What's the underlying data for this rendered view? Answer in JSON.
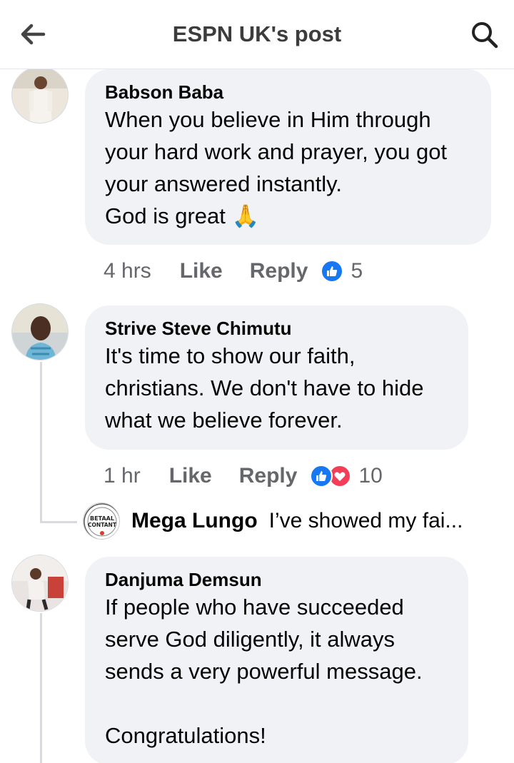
{
  "header": {
    "title": "ESPN UK's post",
    "back_icon": "back-arrow-icon",
    "search_icon": "search-icon"
  },
  "comments": [
    {
      "author": "Babson Baba",
      "text": "When you believe in Him through\nyour hard work and prayer, you got\nyour answered instantly.\nGod is great",
      "emoji": "🙏",
      "time": "4 hrs",
      "like_label": "Like",
      "reply_label": "Reply",
      "reactions": [
        "like"
      ],
      "reaction_count": "5"
    },
    {
      "author": "Strive Steve Chimutu",
      "text": "It's time to show our faith,\nchristians. We don't have to hide\nwhat we believe forever.",
      "time": "1 hr",
      "like_label": "Like",
      "reply_label": "Reply",
      "reactions": [
        "like",
        "love"
      ],
      "reaction_count": "10",
      "reply_preview": {
        "author": "Mega Lungo",
        "text": "I’ve showed my fai...",
        "avatar_text": "BETAAL CONTANT"
      }
    },
    {
      "author": "Danjuma Demsun",
      "text": "If people who have succeeded\nserve God diligently, it always\nsends a very powerful message.\n\nCongratulations!"
    }
  ],
  "colors": {
    "like_blue": "#1877f2",
    "love_red": "#f33e58",
    "bubble_bg": "#f0f2f5",
    "meta_gray": "#65676b"
  }
}
